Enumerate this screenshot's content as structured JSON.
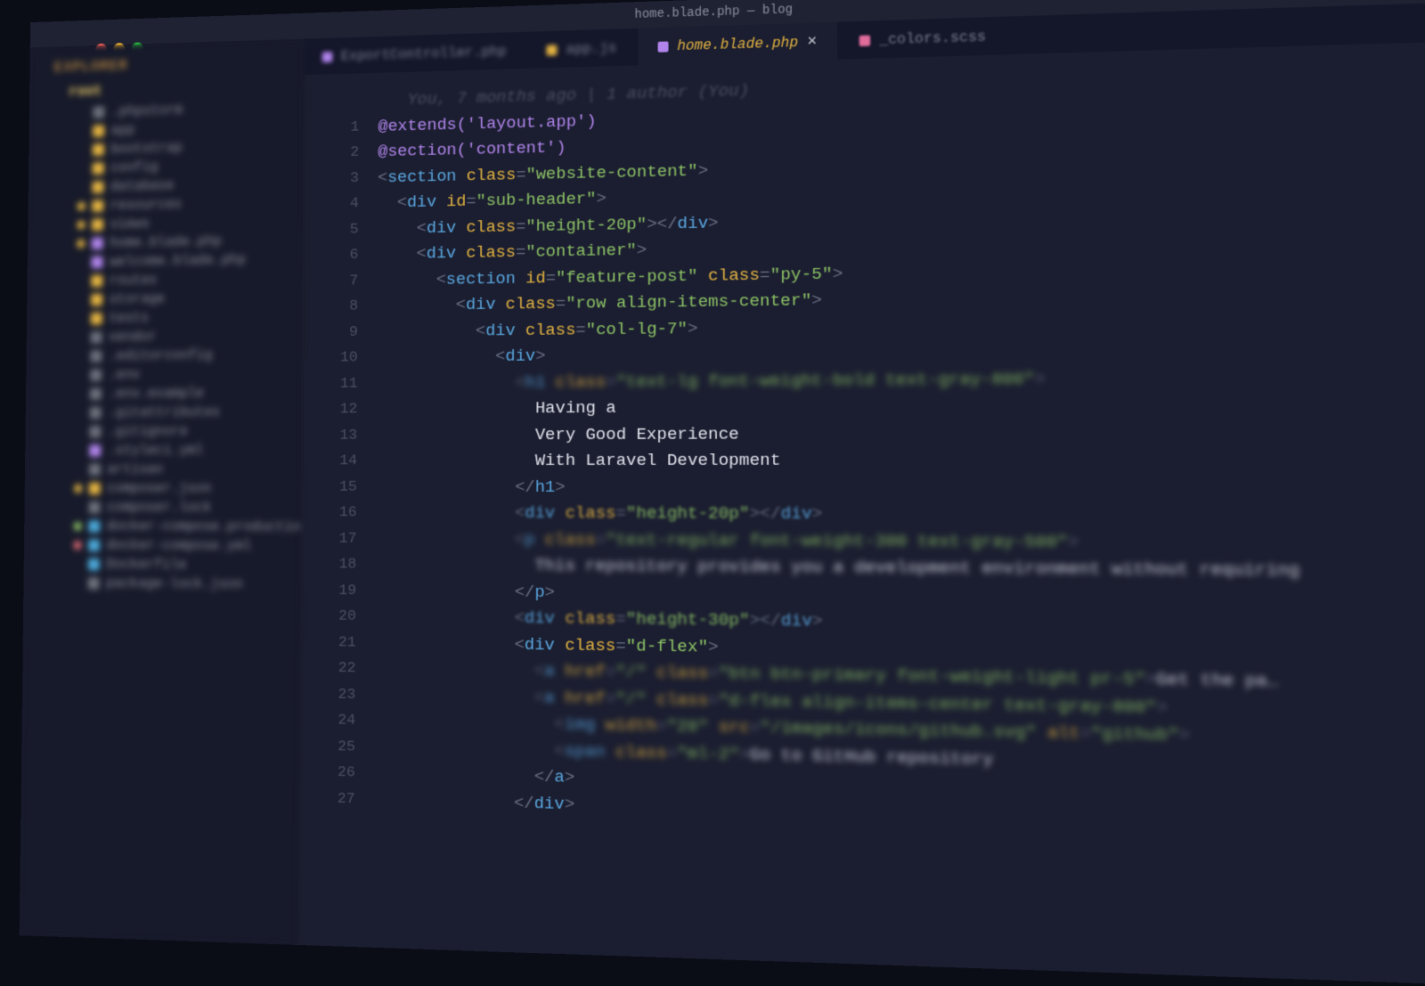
{
  "window": {
    "title": "home.blade.php — blog"
  },
  "sidebar": {
    "section_title": "EXPLORER",
    "root": "root",
    "items": [
      {
        "label": ".phpstorm",
        "icon": "fi-gray",
        "git": "gm-none"
      },
      {
        "label": "app",
        "icon": "fi-yellow",
        "git": "gm-none"
      },
      {
        "label": "bootstrap",
        "icon": "fi-yellow",
        "git": "gm-none"
      },
      {
        "label": "config",
        "icon": "fi-yellow",
        "git": "gm-none"
      },
      {
        "label": "database",
        "icon": "fi-yellow",
        "git": "gm-none"
      },
      {
        "label": "resources",
        "icon": "fi-yellow",
        "git": "gm-mod"
      },
      {
        "label": "views",
        "icon": "fi-yellow",
        "git": "gm-mod"
      },
      {
        "label": "home.blade.php",
        "icon": "fi-purple",
        "git": "gm-mod"
      },
      {
        "label": "welcome.blade.php",
        "icon": "fi-purple",
        "git": "gm-none"
      },
      {
        "label": "routes",
        "icon": "fi-yellow",
        "git": "gm-none"
      },
      {
        "label": "storage",
        "icon": "fi-yellow",
        "git": "gm-none"
      },
      {
        "label": "tests",
        "icon": "fi-yellow",
        "git": "gm-none"
      },
      {
        "label": "vendor",
        "icon": "fi-gray",
        "git": "gm-none"
      },
      {
        "label": ".editorconfig",
        "icon": "fi-gray",
        "git": "gm-none"
      },
      {
        "label": ".env",
        "icon": "fi-gray",
        "git": "gm-none"
      },
      {
        "label": ".env.example",
        "icon": "fi-gray",
        "git": "gm-none"
      },
      {
        "label": ".gitattributes",
        "icon": "fi-gray",
        "git": "gm-none"
      },
      {
        "label": ".gitignore",
        "icon": "fi-gray",
        "git": "gm-none"
      },
      {
        "label": ".styleci.yml",
        "icon": "fi-purple",
        "git": "gm-none"
      },
      {
        "label": "artisan",
        "icon": "fi-gray",
        "git": "gm-none"
      },
      {
        "label": "composer.json",
        "icon": "fi-yellow",
        "git": "gm-mod"
      },
      {
        "label": "composer.lock",
        "icon": "fi-gray",
        "git": "gm-none"
      },
      {
        "label": "docker-compose.production.yml",
        "icon": "fi-docker",
        "git": "gm-unt"
      },
      {
        "label": "docker-compose.yml",
        "icon": "fi-docker",
        "git": "gm-del"
      },
      {
        "label": "Dockerfile",
        "icon": "fi-docker",
        "git": "gm-none"
      },
      {
        "label": "package-lock.json",
        "icon": "fi-gray",
        "git": "gm-none"
      }
    ]
  },
  "tabs": [
    {
      "label": "ExportController.php",
      "icon": "ti-purple",
      "active": false
    },
    {
      "label": "app.js",
      "icon": "ti-yellow",
      "active": false
    },
    {
      "label": "home.blade.php",
      "icon": "ti-purple",
      "active": true
    },
    {
      "label": "_colors.scss",
      "icon": "ti-pink",
      "active": false
    }
  ],
  "blame": "You, 7 months ago | 1 author (You)",
  "code_lines": [
    {
      "n": 1,
      "indent": 0,
      "kind": "dir",
      "text": "@extends('layout.app')"
    },
    {
      "n": 2,
      "indent": 0,
      "kind": "dir",
      "text": "@section('content')"
    },
    {
      "n": 3,
      "indent": 0,
      "kind": "open",
      "tag": "section",
      "attrs": [
        [
          "class",
          "website-content"
        ]
      ]
    },
    {
      "n": 4,
      "indent": 1,
      "kind": "open",
      "tag": "div",
      "attrs": [
        [
          "id",
          "sub-header"
        ]
      ]
    },
    {
      "n": 5,
      "indent": 2,
      "kind": "selfclose",
      "tag": "div",
      "attrs": [
        [
          "class",
          "height-20p"
        ]
      ]
    },
    {
      "n": 6,
      "indent": 2,
      "kind": "open",
      "tag": "div",
      "attrs": [
        [
          "class",
          "container"
        ]
      ]
    },
    {
      "n": 7,
      "indent": 3,
      "kind": "open",
      "tag": "section",
      "attrs": [
        [
          "id",
          "feature-post"
        ],
        [
          "class",
          "py-5"
        ]
      ]
    },
    {
      "n": 8,
      "indent": 4,
      "kind": "open",
      "tag": "div",
      "attrs": [
        [
          "class",
          "row align-items-center"
        ]
      ]
    },
    {
      "n": 9,
      "indent": 5,
      "kind": "open",
      "tag": "div",
      "attrs": [
        [
          "class",
          "col-lg-7"
        ]
      ]
    },
    {
      "n": 10,
      "indent": 6,
      "kind": "open",
      "tag": "div",
      "attrs": []
    },
    {
      "n": 11,
      "indent": 7,
      "kind": "open",
      "tag": "h1",
      "attrs": [
        [
          "class",
          "text-lg font-weight-bold text-gray-800"
        ]
      ],
      "blur": "blur-far"
    },
    {
      "n": 12,
      "indent": 8,
      "kind": "text",
      "text": "Having a"
    },
    {
      "n": 13,
      "indent": 8,
      "kind": "text",
      "text": "Very Good Experience"
    },
    {
      "n": 14,
      "indent": 8,
      "kind": "text",
      "text": "With Laravel Development"
    },
    {
      "n": 15,
      "indent": 7,
      "kind": "close",
      "tag": "h1"
    },
    {
      "n": 16,
      "indent": 7,
      "kind": "selfclose",
      "tag": "div",
      "attrs": [
        [
          "class",
          "height-20p"
        ]
      ],
      "blur": "blur-mid"
    },
    {
      "n": 17,
      "indent": 7,
      "kind": "open",
      "tag": "p",
      "attrs": [
        [
          "class",
          "text-regular font-weight-300 text-gray-500"
        ]
      ],
      "blur": "blur-far"
    },
    {
      "n": 18,
      "indent": 8,
      "kind": "text",
      "text": "This repository provides you a development environment without requiring",
      "blur": "blur-far"
    },
    {
      "n": 19,
      "indent": 7,
      "kind": "close",
      "tag": "p"
    },
    {
      "n": 20,
      "indent": 7,
      "kind": "selfclose",
      "tag": "div",
      "attrs": [
        [
          "class",
          "height-30p"
        ]
      ],
      "blur": "blur-mid"
    },
    {
      "n": 21,
      "indent": 7,
      "kind": "open",
      "tag": "div",
      "attrs": [
        [
          "class",
          "d-flex"
        ]
      ]
    },
    {
      "n": 22,
      "indent": 8,
      "kind": "open",
      "tag": "a",
      "attrs": [
        [
          "href",
          "/"
        ],
        [
          "class",
          "btn btn-primary font-weight-light pr-5"
        ]
      ],
      "tail": "Get the pa…",
      "blur": "blur-far"
    },
    {
      "n": 23,
      "indent": 8,
      "kind": "open",
      "tag": "a",
      "attrs": [
        [
          "href",
          "/"
        ],
        [
          "class",
          "d-flex align-items-center text-gray-800"
        ]
      ],
      "blur": "blur-far"
    },
    {
      "n": 24,
      "indent": 9,
      "kind": "open",
      "tag": "img",
      "attrs": [
        [
          "width",
          "20"
        ],
        [
          "src",
          "/images/icons/github.svg"
        ],
        [
          "alt",
          "github"
        ]
      ],
      "blur": "blur-far"
    },
    {
      "n": 25,
      "indent": 9,
      "kind": "open",
      "tag": "span",
      "attrs": [
        [
          "class",
          "ml-2"
        ]
      ],
      "tail": "Go to GitHub repository </span>",
      "blur": "blur-far"
    },
    {
      "n": 26,
      "indent": 8,
      "kind": "close",
      "tag": "a"
    },
    {
      "n": 27,
      "indent": 7,
      "kind": "close",
      "tag": "div"
    }
  ]
}
